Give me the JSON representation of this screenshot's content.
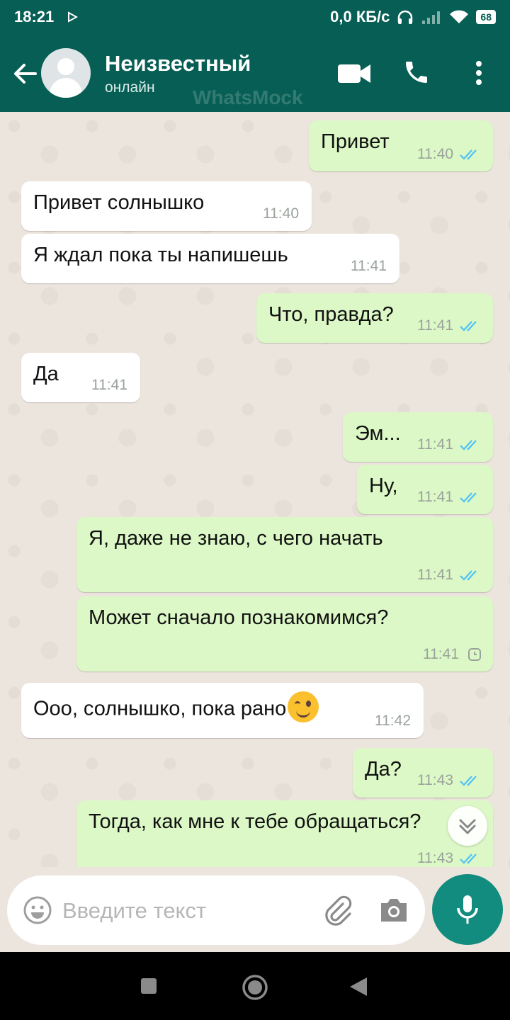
{
  "status_bar": {
    "time": "18:21",
    "speed": "0,0 КБ/с",
    "battery": "68",
    "icons": [
      "play-icon",
      "headphones-icon",
      "signal-icon",
      "wifi-icon",
      "battery-icon"
    ]
  },
  "header": {
    "contact_name": "Неизвестный",
    "contact_status": "онлайн",
    "watermark": "WhatsMock",
    "icons": [
      "back-arrow-icon",
      "video-call-icon",
      "phone-icon",
      "more-vert-icon"
    ],
    "colors": {
      "header_bg": "#075e54",
      "accent": "#128c7e"
    }
  },
  "messages": [
    {
      "direction": "out",
      "text": "Привет",
      "time": "11:40",
      "status": "read"
    },
    {
      "direction": "in",
      "text": "Привет солнышко",
      "time": "11:40"
    },
    {
      "direction": "in",
      "text": "Я ждал пока ты напишешь",
      "time": "11:41"
    },
    {
      "direction": "out",
      "text": "Что, правда?",
      "time": "11:41",
      "status": "read"
    },
    {
      "direction": "in",
      "text": "Да",
      "time": "11:41"
    },
    {
      "direction": "out",
      "text": "Эм...",
      "time": "11:41",
      "status": "read"
    },
    {
      "direction": "out",
      "text": "Ну,",
      "time": "11:41",
      "status": "read"
    },
    {
      "direction": "out",
      "text": "Я, даже не знаю, с чего начать",
      "time": "11:41",
      "status": "read"
    },
    {
      "direction": "out",
      "text": "Может сначало познакомимся?",
      "time": "11:41",
      "status": "pending"
    },
    {
      "direction": "in",
      "text": "Ооо, солнышко, пока рано",
      "emoji": "winking-face",
      "time": "11:42"
    },
    {
      "direction": "out",
      "text": "Да?",
      "time": "11:43",
      "status": "read"
    },
    {
      "direction": "out",
      "text": "Тогда, как мне к тебе обращаться?",
      "time": "11:43",
      "status": "read"
    }
  ],
  "input": {
    "placeholder": "Введите текст",
    "icons": [
      "emoji-icon",
      "attach-icon",
      "camera-icon",
      "mic-icon"
    ]
  },
  "nav_bar": {
    "icons": [
      "recents-icon",
      "home-icon",
      "back-icon"
    ]
  },
  "colors": {
    "chat_bg": "#ece5dd",
    "bubble_out": "#dcf8c6",
    "bubble_in": "#ffffff",
    "read_ticks": "#4fc3f7"
  }
}
